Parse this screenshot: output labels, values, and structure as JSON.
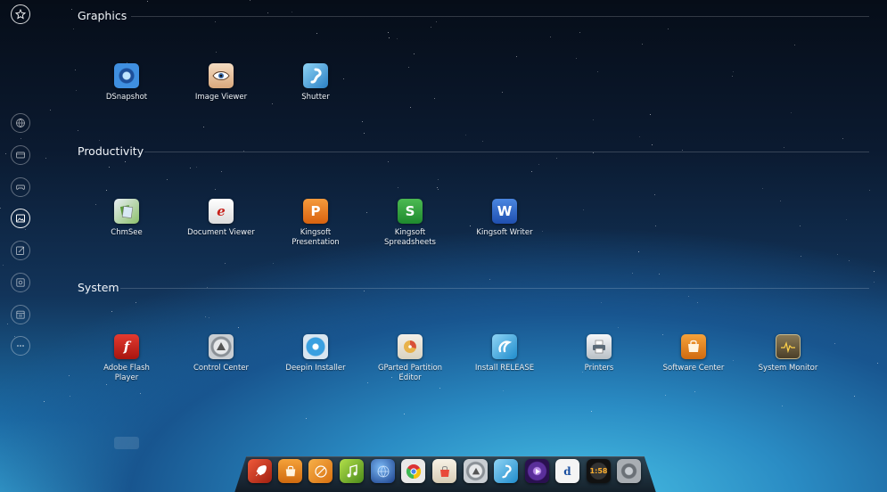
{
  "sidebar": {
    "items": [
      {
        "name": "favorites",
        "icon": "star-icon"
      },
      {
        "name": "internet",
        "icon": "globe-icon"
      },
      {
        "name": "multimedia",
        "icon": "video-icon"
      },
      {
        "name": "games",
        "icon": "gamepad-icon"
      },
      {
        "name": "graphics",
        "icon": "picture-icon",
        "active": true
      },
      {
        "name": "productivity",
        "icon": "edit-icon"
      },
      {
        "name": "system",
        "icon": "settings-icon"
      },
      {
        "name": "utilities",
        "icon": "calendar-icon"
      },
      {
        "name": "others",
        "icon": "more-icon"
      }
    ]
  },
  "sections": {
    "graphics": {
      "title": "Graphics",
      "apps": [
        {
          "label": "DSnapshot",
          "icon": "camera-icon",
          "color": "#2f7fd6"
        },
        {
          "label": "Image Viewer",
          "icon": "eye-icon",
          "color": "#e9c9a8"
        },
        {
          "label": "Shutter",
          "icon": "shutter-icon",
          "color": "#3a9fd9"
        }
      ]
    },
    "productivity": {
      "title": "Productivity",
      "apps": [
        {
          "label": "ChmSee",
          "icon": "book-icon",
          "color": "#8ab86a"
        },
        {
          "label": "Document Viewer",
          "icon": "document-icon",
          "color": "#f2f2f2"
        },
        {
          "label": "Kingsoft Presentation",
          "line1": "Kingsoft",
          "line2": "Presentation",
          "icon": "presentation-icon",
          "color": "#e8731c"
        },
        {
          "label": "Kingsoft Spreadsheets",
          "line1": "Kingsoft",
          "line2": "Spreadsheets",
          "icon": "spreadsheet-icon",
          "color": "#2e9a3c"
        },
        {
          "label": "Kingsoft Writer",
          "icon": "writer-icon",
          "color": "#2b64c8"
        }
      ]
    },
    "system": {
      "title": "System",
      "apps": [
        {
          "label": "Adobe Flash Player",
          "line1": "Adobe Flash",
          "line2": "Player",
          "icon": "flash-icon",
          "color": "#c8221c"
        },
        {
          "label": "Control Center",
          "icon": "control-icon",
          "color": "#9aa0a6"
        },
        {
          "label": "Deepin Installer",
          "icon": "installer-icon",
          "color": "#2f8fd0"
        },
        {
          "label": "GParted Partition Editor",
          "line1": "GParted Partition",
          "line2": "Editor",
          "icon": "disk-icon",
          "color": "#e7c07a"
        },
        {
          "label": "Install RELEASE",
          "icon": "install-icon",
          "color": "#2aa5d8"
        },
        {
          "label": "Printers",
          "icon": "printer-icon",
          "color": "#d8dde2"
        },
        {
          "label": "Software Center",
          "icon": "store-icon",
          "color": "#e88a1c"
        },
        {
          "label": "System Monitor",
          "icon": "monitor-icon",
          "color": "#6a5a3a"
        }
      ]
    }
  },
  "dock": {
    "items": [
      {
        "name": "launcher",
        "icon": "rocket-icon",
        "color": "#c8321c"
      },
      {
        "name": "software-center",
        "icon": "store-icon",
        "color": "#e88a1c"
      },
      {
        "name": "music",
        "icon": "music-icon",
        "color": "#e0861a"
      },
      {
        "name": "music-player",
        "icon": "note-icon",
        "color": "#6fa72a"
      },
      {
        "name": "browser",
        "icon": "globe-icon",
        "color": "#2a5fb8"
      },
      {
        "name": "chrome",
        "icon": "chrome-icon",
        "color": "#d8d8d8"
      },
      {
        "name": "software-store",
        "icon": "bag-icon",
        "color": "#e9e1d0"
      },
      {
        "name": "control-center",
        "icon": "control-icon",
        "color": "#9aa0a6"
      },
      {
        "name": "installer",
        "icon": "installer-icon",
        "color": "#2f8fd0"
      },
      {
        "name": "media-player",
        "icon": "play-icon",
        "color": "#6b3fa8"
      },
      {
        "name": "deepin",
        "icon": "d-icon",
        "color": "#ececec"
      },
      {
        "name": "clock",
        "icon": "clock-icon",
        "color": "#222222"
      },
      {
        "name": "settings",
        "icon": "settings-icon",
        "color": "#8d9398"
      }
    ],
    "clock_text": "1:58"
  }
}
